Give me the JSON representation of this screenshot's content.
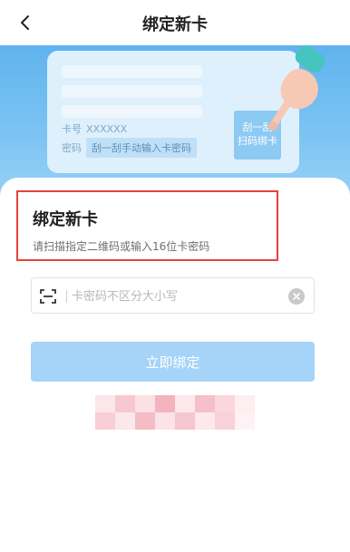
{
  "nav": {
    "title": "绑定新卡",
    "back_icon": "chevron-left-icon"
  },
  "illustration": {
    "card_no_label": "卡号",
    "card_no_value": "XXXXXX",
    "password_label": "密码",
    "password_hint": "刮一刮手动输入卡密码",
    "scratch_button": "刮一刮\n扫码绑卡"
  },
  "form": {
    "title": "绑定新卡",
    "subtitle": "请扫描指定二维码或输入16位卡密码",
    "input_placeholder": "卡密码不区分大小写",
    "input_value": "",
    "scan_icon": "scan-icon",
    "clear_icon": "clear-icon",
    "submit_label": "立即绑定",
    "accent_color": "#a6d3f8",
    "highlight_color": "#e8413a"
  }
}
